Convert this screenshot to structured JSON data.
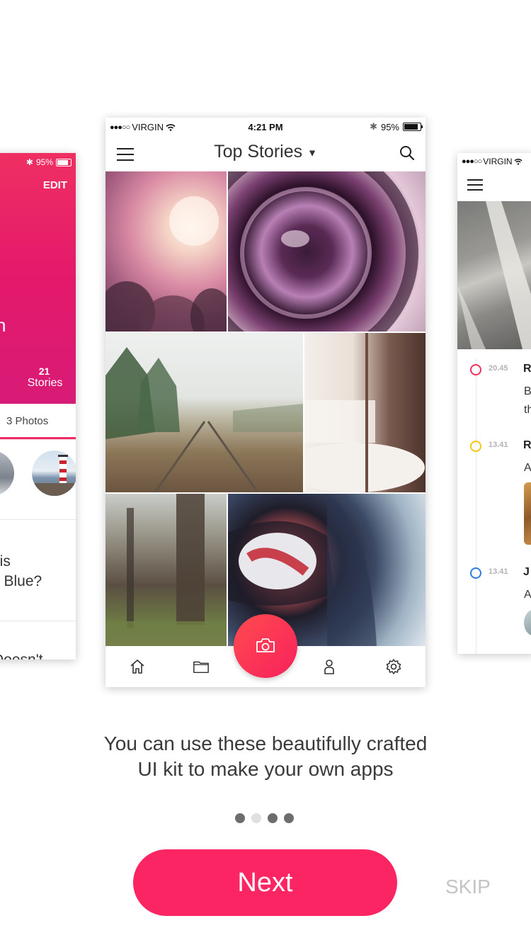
{
  "center_card": {
    "status": {
      "carrier": "VIRGIN",
      "time": "4:21 PM",
      "battery": "95%"
    },
    "nav_title": "Top Stories",
    "tabbar": {
      "items": [
        "home-icon",
        "folder-icon",
        "camera-icon",
        "profile-icon",
        "settings-icon"
      ]
    }
  },
  "left_card": {
    "status_battery": "95%",
    "edit_label": "EDIT",
    "name_fragment": "n",
    "stories_count": "21",
    "stories_label": "Stories",
    "photos_tab": "3 Photos",
    "question_line1": "his",
    "question_line2": "o Blue?",
    "cut_text": "Doesn't"
  },
  "right_card": {
    "status_carrier": "VIRGIN",
    "items": [
      {
        "time": "20.45",
        "initial": "R",
        "line1": "B",
        "line2": "th",
        "ring_color": "#f0325d"
      },
      {
        "time": "13.41",
        "initial": "R",
        "line1": "A",
        "line2": "",
        "ring_color": "#f5c518"
      },
      {
        "time": "13.41",
        "initial": "J",
        "line1": "A",
        "line2": "",
        "ring_color": "#2e7de0"
      }
    ]
  },
  "onboarding": {
    "caption_line1": "You can use these beautifully crafted",
    "caption_line2": "UI kit to make your own apps",
    "pager_active_indices": [
      0,
      2,
      3
    ],
    "next_label": "Next",
    "skip_label": "SKIP"
  },
  "colors": {
    "accent": "#fb2563",
    "header_gradient": "#e4196b"
  }
}
